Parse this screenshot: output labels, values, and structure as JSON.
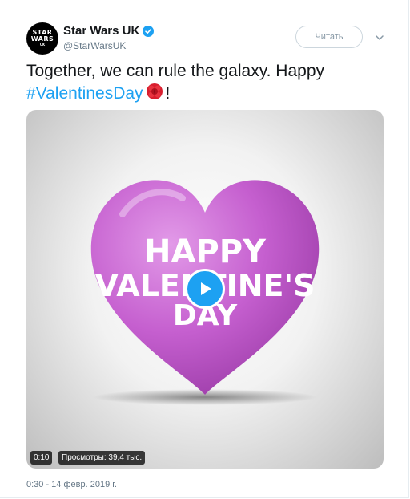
{
  "account": {
    "display_name": "Star Wars UK",
    "handle": "@StarWarsUK",
    "avatar_text": [
      "STAR",
      "WARS",
      "UK"
    ],
    "verified": true
  },
  "actions": {
    "follow_label": "Читать",
    "more_icon": "chevron-down-icon"
  },
  "tweet": {
    "text_plain": "Together, we can rule the galaxy. Happy",
    "hashtag": "#ValentinesDay",
    "emoji_icon": "rose-icon",
    "text_end": "!"
  },
  "media": {
    "overlay_text": [
      "HAPPY",
      "VALENTINE'S",
      "DAY"
    ],
    "duration": "0:10",
    "views": "Просмотры: 39,4 тыс.",
    "play_icon": "play-icon"
  },
  "meta": {
    "timestamp": "0:30 - 14 февр. 2019 г."
  },
  "colors": {
    "accent": "#1da1f2",
    "heart": "#c95ed1",
    "text": "#14171a",
    "muted": "#657786"
  }
}
